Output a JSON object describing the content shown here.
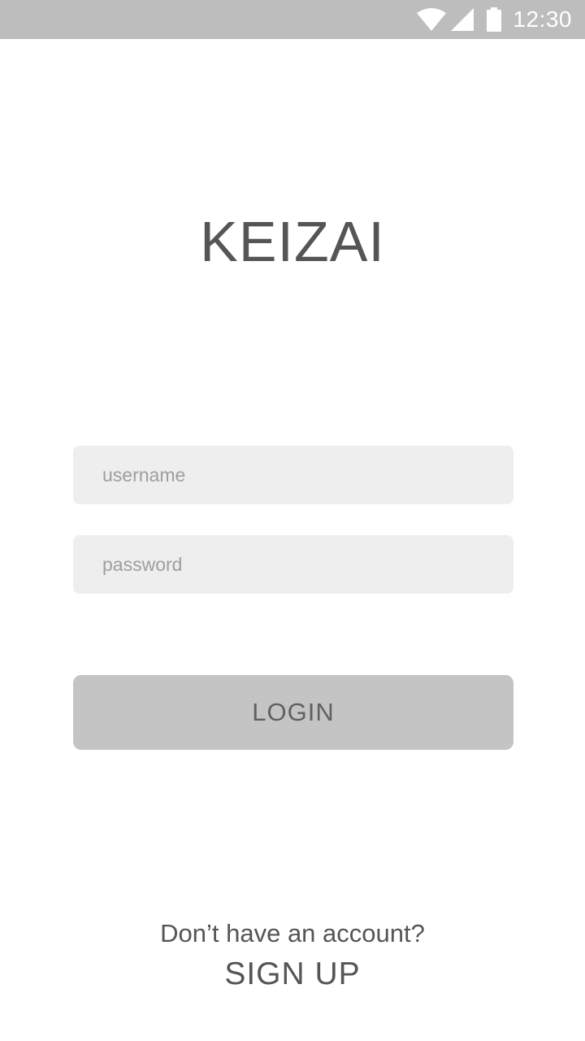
{
  "status_bar": {
    "time": "12:30",
    "icons": [
      "wifi-icon",
      "cell-signal-icon",
      "battery-icon"
    ]
  },
  "app": {
    "title": "KEIZAI"
  },
  "form": {
    "username_placeholder": "username",
    "username_value": "",
    "password_placeholder": "password",
    "password_value": "",
    "login_label": "LOGIN"
  },
  "footer": {
    "prompt": "Don’t have an account?",
    "signup_label": "SIGN UP"
  },
  "colors": {
    "status_bar_bg": "#bdbdbd",
    "text_primary": "#555555",
    "input_bg": "#eeeeee",
    "placeholder": "#9e9e9e",
    "button_bg": "#c4c4c4"
  }
}
